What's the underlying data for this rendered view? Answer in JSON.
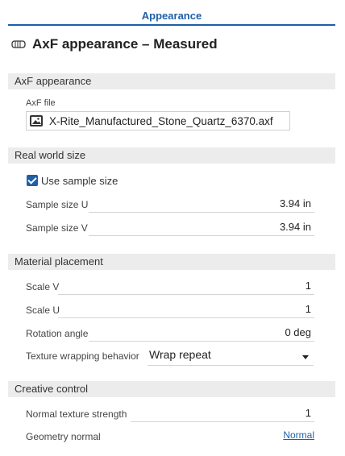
{
  "tab": {
    "label": "Appearance"
  },
  "header": {
    "title": "AxF appearance – Measured",
    "icon": "material-icon"
  },
  "sections": {
    "axf": {
      "title": "AxF appearance",
      "file_label": "AxF file",
      "file_name": "X-Rite_Manufactured_Stone_Quartz_6370.axf",
      "file_icon": "image-icon"
    },
    "real_world": {
      "title": "Real world size",
      "use_sample_label": "Use sample size",
      "use_sample_checked": true,
      "sample_u_label": "Sample size U",
      "sample_u_value": "3.94 in",
      "sample_v_label": "Sample size V",
      "sample_v_value": "3.94 in"
    },
    "placement": {
      "title": "Material placement",
      "scale_v_label": "Scale V",
      "scale_v_value": "1",
      "scale_u_label": "Scale U",
      "scale_u_value": "1",
      "rotation_label": "Rotation angle",
      "rotation_value": "0 deg",
      "wrapping_label": "Texture wrapping behavior",
      "wrapping_value": "Wrap repeat"
    },
    "creative": {
      "title": "Creative control",
      "normal_strength_label": "Normal texture strength",
      "normal_strength_value": "1",
      "geometry_normal_label": "Geometry normal",
      "geometry_normal_value": "Normal"
    }
  },
  "colors": {
    "accent": "#1f5fa8",
    "section_bg": "#ececec"
  }
}
